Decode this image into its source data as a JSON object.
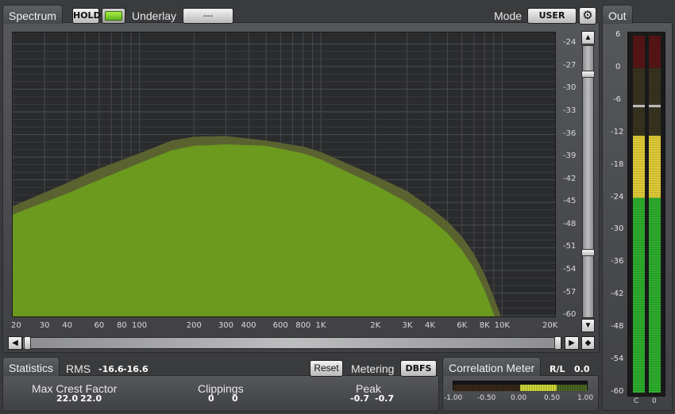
{
  "spectrum": {
    "tab_label": "Spectrum",
    "hold_label": "HOLD",
    "underlay_label": "Underlay",
    "underlay_value": "---",
    "mode_label": "Mode",
    "mode_value": "USER",
    "db_ticks": [
      "-24",
      "-27",
      "-30",
      "-33",
      "-36",
      "-39",
      "-42",
      "-45",
      "-48",
      "-51",
      "-54",
      "-57",
      "-60"
    ],
    "freq_ticks": [
      "20",
      "30",
      "40",
      "60",
      "80",
      "100",
      "200",
      "300",
      "400",
      "600",
      "800",
      "1K",
      "2K",
      "3K",
      "4K",
      "6K",
      "8K",
      "10K",
      "20K"
    ],
    "colors": {
      "fill": "#6b9a1e",
      "hold": "#5a6330",
      "background": "#2a2b2d",
      "led": "#7fd02a"
    }
  },
  "out": {
    "tab_label": "Out",
    "scale": [
      "6",
      "0",
      "-6",
      "-12",
      "-18",
      "-24",
      "-30",
      "-36",
      "-42",
      "-48",
      "-54",
      "-60"
    ],
    "channel_labels": [
      "C",
      "0"
    ],
    "colors": {
      "green": "#2fb32f",
      "yellow": "#e8d23a",
      "red": "#7a1c1c"
    }
  },
  "statistics": {
    "tab_label": "Statistics",
    "rms_label": "RMS",
    "rms_left": "-16.6",
    "rms_right": "-16.6",
    "reset_label": "Reset",
    "metering_label": "Metering",
    "metering_value": "DBFS",
    "crest_label": "Max Crest Factor",
    "crest_left": "22.0",
    "crest_right": "22.0",
    "clip_label": "Clippings",
    "clip_left": "0",
    "clip_right": "0",
    "peak_label": "Peak",
    "peak_left": "-0.7",
    "peak_right": "-0.7"
  },
  "correlation": {
    "tab_label": "Correlation Meter",
    "rl_label": "R/L",
    "rl_value": "0.0",
    "scale": [
      "-1.00",
      "-0.50",
      "0.00",
      "0.50",
      "1.00"
    ]
  }
}
